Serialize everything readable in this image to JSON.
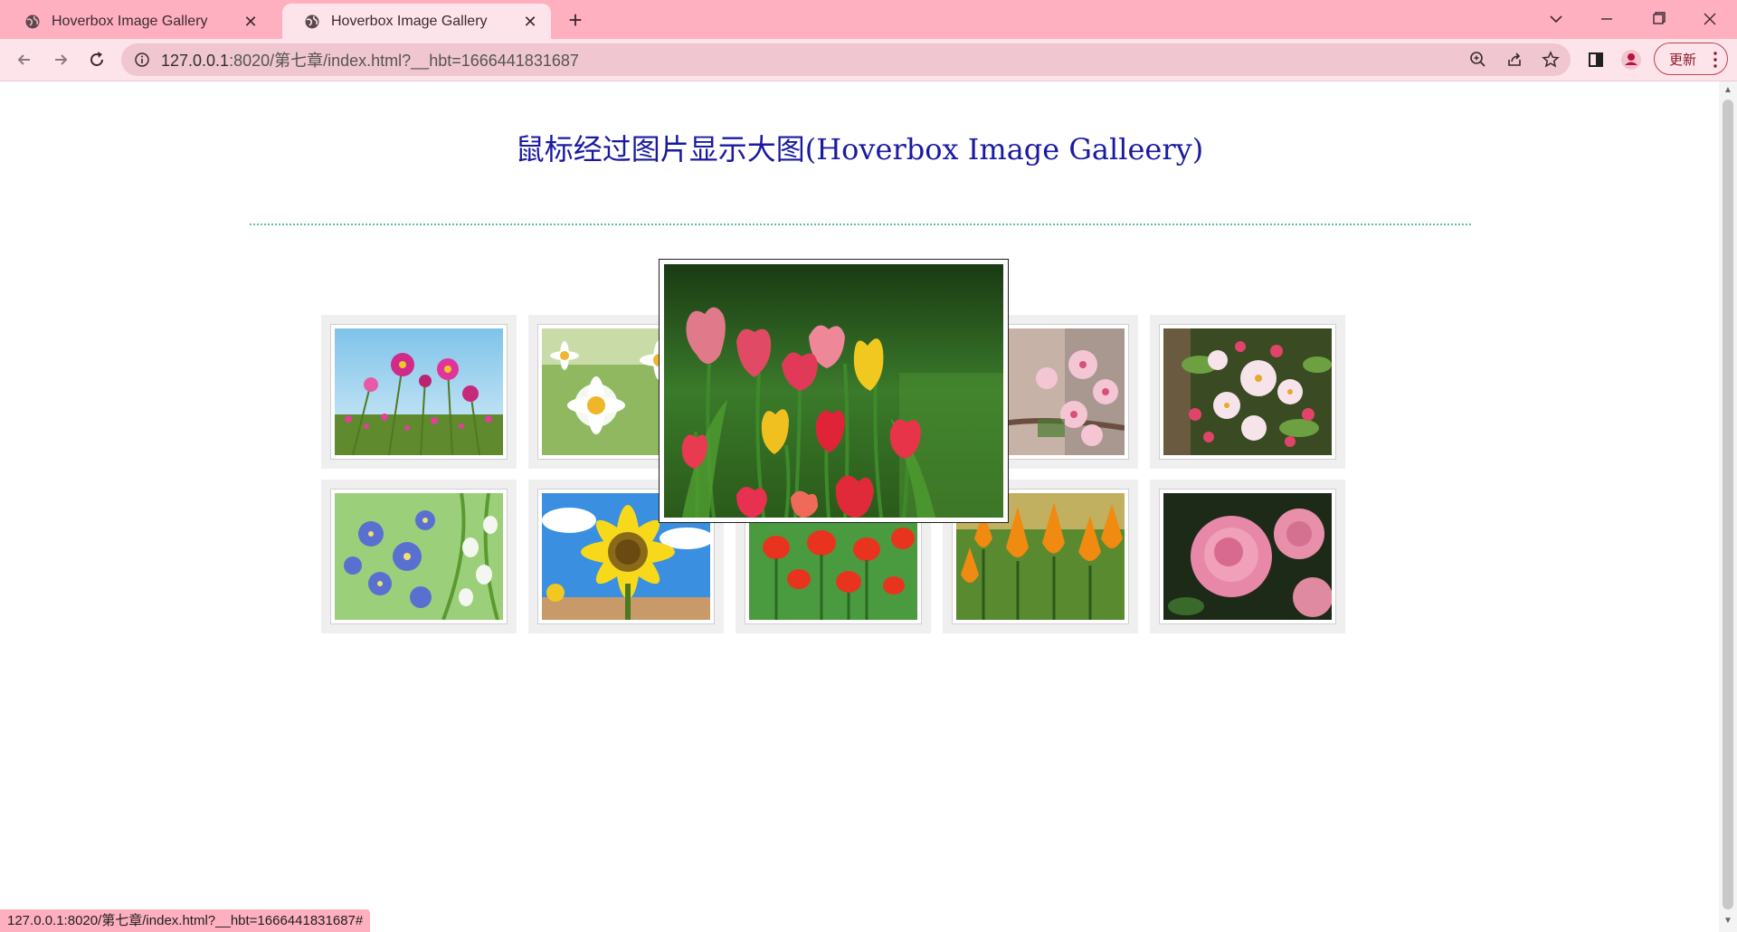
{
  "tabs": [
    {
      "title": "Hoverbox Image Gallery",
      "active": false
    },
    {
      "title": "Hoverbox Image Gallery",
      "active": true
    }
  ],
  "toolbar": {
    "url_host": "127.0.0.1",
    "url_rest": ":8020/第七章/index.html?__hbt=1666441831687",
    "update_label": "更新"
  },
  "page": {
    "title": "鼠标经过图片显示大图(Hoverbox Image Galleery)"
  },
  "gallery": {
    "items": [
      {
        "name": "cosmos"
      },
      {
        "name": "daisy"
      },
      {
        "name": "tulip-pink"
      },
      {
        "name": "pink-blossom"
      },
      {
        "name": "apple-blossom"
      },
      {
        "name": "forget-me-not"
      },
      {
        "name": "sunflower"
      },
      {
        "name": "red-tulips"
      },
      {
        "name": "orange-tulips"
      },
      {
        "name": "pink-rose"
      }
    ],
    "hovered_index": 2
  },
  "status": {
    "link": "127.0.0.1:8020/第七章/index.html?__hbt=1666441831687#"
  },
  "colors": {
    "tab_strip": "#ffb0c0",
    "toolbar": "#fde4ea",
    "title_text": "#1a1aa0",
    "divider": "#66b8a8"
  }
}
